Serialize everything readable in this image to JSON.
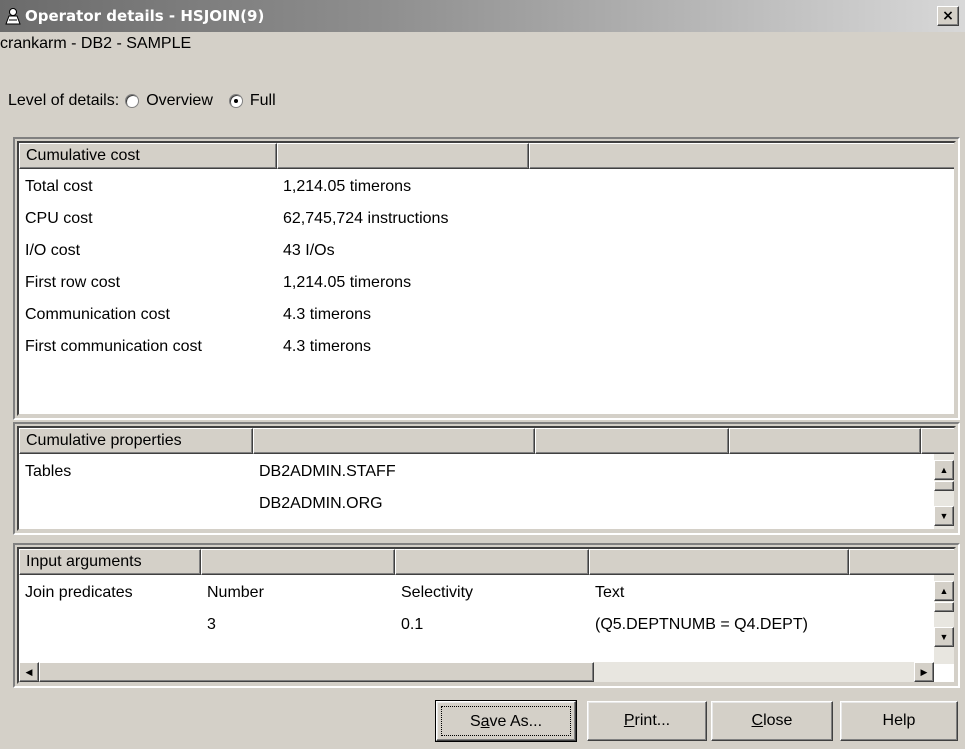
{
  "window": {
    "title": "Operator details - HSJOIN(9)",
    "close_glyph": "×",
    "icon": "operator-icon"
  },
  "connection": "crankarm - DB2 - SAMPLE",
  "level_of_details": {
    "label": "Level of details:",
    "options": [
      {
        "label": "Overview",
        "selected": false
      },
      {
        "label": "Full",
        "selected": true
      }
    ]
  },
  "cumulative_cost": {
    "headers": [
      "Cumulative cost",
      "",
      ""
    ],
    "rows": [
      {
        "name": "Total cost",
        "value": "1,214.05 timerons"
      },
      {
        "name": "CPU cost",
        "value": "62,745,724 instructions"
      },
      {
        "name": "I/O cost",
        "value": "43 I/Os"
      },
      {
        "name": "First row cost",
        "value": "1,214.05 timerons"
      },
      {
        "name": "Communication cost",
        "value": "4.3 timerons"
      },
      {
        "name": "First communication cost",
        "value": "4.3 timerons"
      }
    ]
  },
  "cumulative_properties": {
    "headers": [
      "Cumulative properties",
      "",
      "",
      "",
      ""
    ],
    "rows": [
      {
        "name": "Tables",
        "value": "DB2ADMIN.STAFF"
      },
      {
        "name": "",
        "value": "DB2ADMIN.ORG"
      }
    ]
  },
  "input_arguments": {
    "headers": [
      "Input arguments",
      "",
      "",
      "",
      ""
    ],
    "rows": [
      {
        "c1": "Join predicates",
        "c2": "Number",
        "c3": "Selectivity",
        "c4": "Text"
      },
      {
        "c1": "",
        "c2": "3",
        "c3": "0.1",
        "c4": "(Q5.DEPTNUMB = Q4.DEPT)"
      }
    ]
  },
  "buttons": {
    "save_as": {
      "pre": "S",
      "mnemonic": "a",
      "post": "ve As..."
    },
    "print": {
      "pre": "",
      "mnemonic": "P",
      "post": "rint..."
    },
    "close": {
      "pre": "",
      "mnemonic": "C",
      "post": "lose"
    },
    "help": {
      "label": "Help"
    }
  }
}
